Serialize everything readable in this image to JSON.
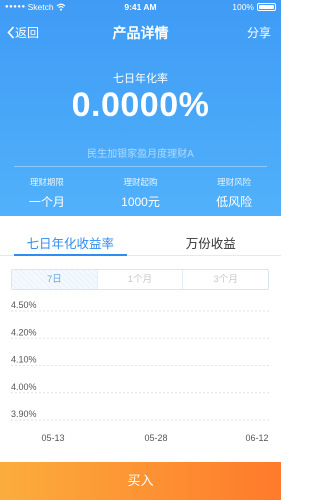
{
  "status_bar": {
    "carrier": "Sketch",
    "time": "9:41 AM",
    "battery": "100%"
  },
  "nav": {
    "back_label": "返回",
    "title": "产品详情",
    "share_label": "分享"
  },
  "hero": {
    "rate_label": "七日年化率",
    "rate_value": "0.0000%",
    "product_name": "民生加银家盈月度理财A",
    "metrics": [
      {
        "label": "理财期限",
        "value": "一个月"
      },
      {
        "label": "理财起购",
        "value": "1000元"
      },
      {
        "label": "理财风险",
        "value": "低风险"
      }
    ]
  },
  "tabs": [
    {
      "label": "七日年化收益率",
      "active": true
    },
    {
      "label": "万份收益",
      "active": false
    }
  ],
  "periods": [
    {
      "label": "7日",
      "active": true
    },
    {
      "label": "1个月",
      "active": false
    },
    {
      "label": "3个月",
      "active": false
    }
  ],
  "chart_data": {
    "type": "line",
    "y_ticks": [
      "4.50%",
      "4.20%",
      "4.10%",
      "4.00%",
      "3.90%"
    ],
    "x_ticks": [
      "05-13",
      "05-28",
      "06-12"
    ],
    "series": [],
    "grid": true,
    "grid_color": "#dde3ea"
  },
  "buy_button": {
    "label": "买入"
  },
  "colors": {
    "accent": "#2f8cf0",
    "hero_top": "#3f9bf5",
    "buy_start": "#fbad3c",
    "buy_end": "#ff7a2b"
  }
}
